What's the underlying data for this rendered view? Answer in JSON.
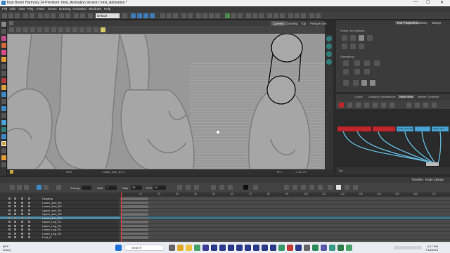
{
  "window": {
    "title": "Toon Boom Harmony 24 Premium: First_Animation Version: First_Animation *",
    "controls": [
      "—",
      "☐",
      "✕"
    ]
  },
  "menu": [
    "File",
    "Edit",
    "View",
    "Play",
    "Insert",
    "Scene",
    "Drawing",
    "Animation",
    "Windows",
    "Help"
  ],
  "toolbar": {
    "workspace": "Default"
  },
  "camera": {
    "tabs": [
      "Camera",
      "Drawing",
      "Top",
      "Perspective"
    ],
    "active_tab": "Camera",
    "status": {
      "zoom": "20%",
      "node": "Lower_Arm_R1-1",
      "frame_label": "Fr 1",
      "coords": "-1.12 .Fc"
    }
  },
  "tool_properties": {
    "tabs": [
      "Tool Properties",
      "Library",
      "Stamp"
    ],
    "section_select": "Select Tool Options",
    "section_operations": "Operations"
  },
  "node_view": {
    "tabs": [
      "Colour",
      "Drawing Substitutions",
      "Node View",
      "Master Controller"
    ],
    "active_tab": "Node View",
    "status_label": "Top",
    "nodes": [
      "Lower_Arm_R1-1",
      "Lower_Arm_R1",
      "Upper_Arm"
    ]
  },
  "timeline": {
    "tabs": [
      "Timeline",
      "Node Library"
    ],
    "playback": {
      "start_label": "Start",
      "start": "1",
      "stop_label": "Stop",
      "stop": "20",
      "fps_label": "FPS",
      "fps": "24",
      "tracing_label": "Tracing"
    },
    "layers": [
      {
        "name": "Drawing",
        "selected": false
      },
      {
        "name": "Lower_Arm_R1",
        "selected": false
      },
      {
        "name": "Lower_Arm_R2",
        "selected": false
      },
      {
        "name": "Upper_Arm_R1",
        "selected": false
      },
      {
        "name": "Upper_Arm_R2",
        "selected": false
      },
      {
        "name": "Lower_Arm_R3",
        "selected": true
      },
      {
        "name": "Upper_Leg_R1",
        "selected": false
      },
      {
        "name": "Upper_Leg_R2",
        "selected": false
      },
      {
        "name": "Lower_Leg_R1",
        "selected": false
      },
      {
        "name": "Lower_Leg_R2",
        "selected": false
      },
      {
        "name": "Foot_R",
        "selected": false
      }
    ],
    "ruler": [
      "1",
      "10",
      "20",
      "30",
      "40",
      "50",
      "60",
      "70",
      "80",
      "90",
      "100",
      "110",
      "120",
      "130",
      "140",
      "150",
      "160",
      "170"
    ]
  },
  "taskbar": {
    "weather_temp": "66°F",
    "weather_desc": "Sunny",
    "search_placeholder": "Search",
    "time": "6:17 PM",
    "date": "7/18/2023"
  },
  "colors": {
    "selection": "#4d8aa6",
    "node_red": "#c0272d",
    "node_blue": "#4aa3d4",
    "accent_teal": "#2f7c7c"
  }
}
